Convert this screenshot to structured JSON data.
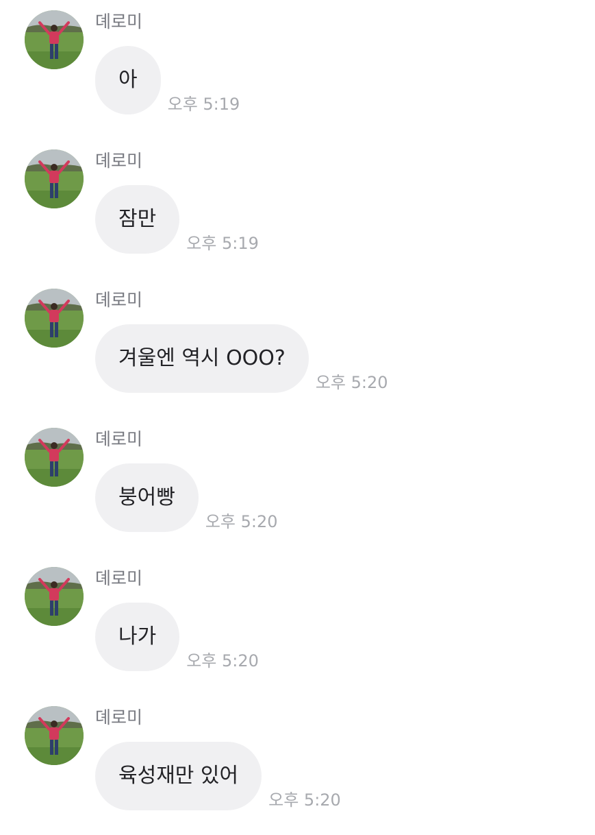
{
  "conversation": {
    "messages": [
      {
        "sender": "뎨로미",
        "text": "아",
        "time": "오후 5:19"
      },
      {
        "sender": "뎨로미",
        "text": "잠만",
        "time": "오후 5:19"
      },
      {
        "sender": "뎨로미",
        "text": "겨울엔 역시 OOO?",
        "time": "오후 5:20"
      },
      {
        "sender": "뎨로미",
        "text": "붕어빵",
        "time": "오후 5:20"
      },
      {
        "sender": "뎨로미",
        "text": "나가",
        "time": "오후 5:20"
      },
      {
        "sender": "뎨로미",
        "text": "육성재만 있어",
        "time": "오후 5:20"
      }
    ]
  },
  "theme": {
    "bubble_color": "#f0f0f2",
    "sender_color": "#777980",
    "time_color": "#a7a9ae",
    "text_color": "#222226",
    "avatar_icon": "profile-photo-person-arms-raised-in-field"
  }
}
